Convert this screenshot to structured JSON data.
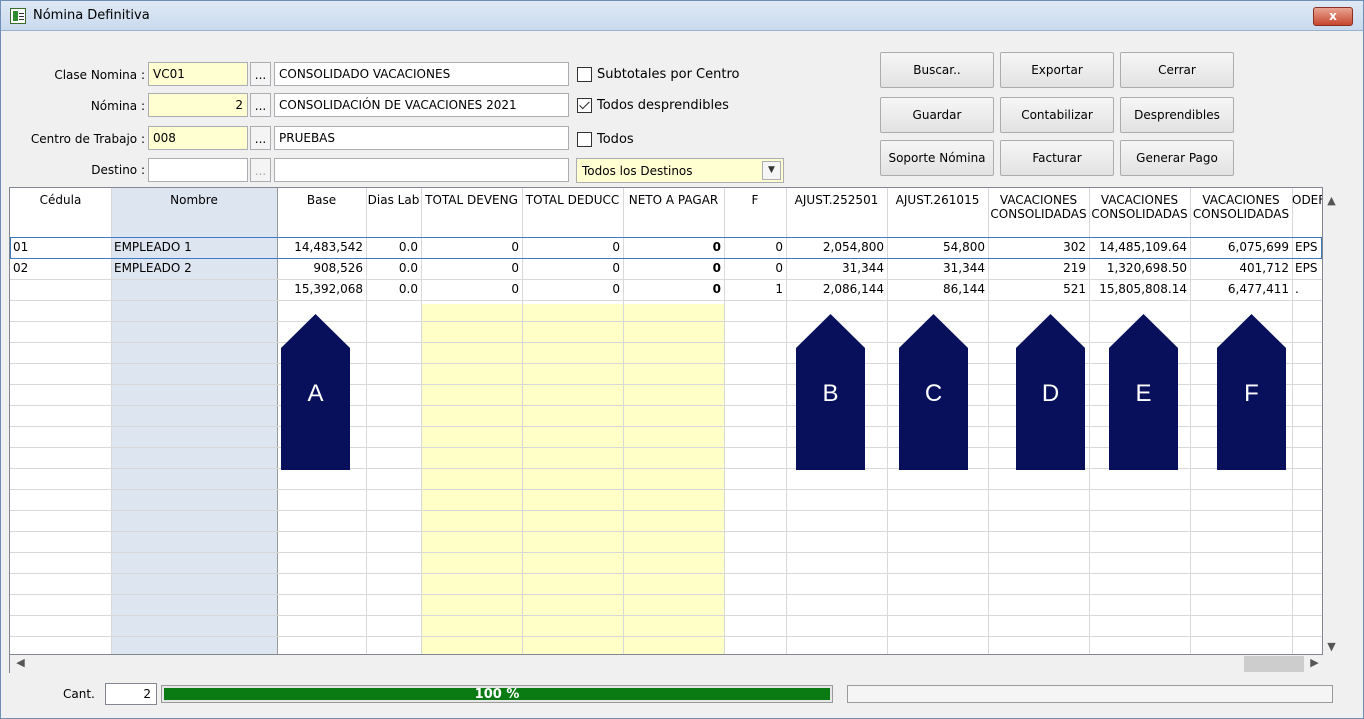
{
  "window": {
    "title": "Nómina Definitiva",
    "close_label": "x"
  },
  "form": {
    "clase_nomina": {
      "label": "Clase Nomina :",
      "code": "VC01",
      "desc": "CONSOLIDADO VACACIONES"
    },
    "nomina": {
      "label": "Nómina :",
      "code": "2",
      "desc": "CONSOLIDACIÓN DE VACACIONES 2021"
    },
    "centro": {
      "label": "Centro de Trabajo :",
      "code": "008",
      "desc": "PRUEBAS"
    },
    "destino": {
      "label": "Destino :",
      "code": "",
      "desc": ""
    },
    "dots": "..."
  },
  "options": {
    "subtotales": {
      "label": "Subtotales por Centro",
      "checked": false
    },
    "desprendibles": {
      "label": "Todos desprendibles",
      "checked": true
    },
    "todos": {
      "label": "Todos",
      "checked": false
    },
    "destinos": {
      "value": "Todos los Destinos"
    }
  },
  "buttons": {
    "buscar": "Buscar..",
    "exportar": "Exportar",
    "cerrar": "Cerrar",
    "guardar": "Guardar",
    "contabilizar": "Contabilizar",
    "desprendibles": "Desprendibles",
    "soporte": "Soporte Nómina",
    "facturar": "Facturar",
    "generar_pago": "Generar Pago"
  },
  "grid": {
    "columns": [
      {
        "line1": "Cédula",
        "line2": ""
      },
      {
        "line1": "Nombre",
        "line2": ""
      },
      {
        "line1": "Base",
        "line2": ""
      },
      {
        "line1": "Dias Lab",
        "line2": ""
      },
      {
        "line1": "TOTAL DEVENG",
        "line2": ""
      },
      {
        "line1": "TOTAL DEDUCC",
        "line2": ""
      },
      {
        "line1": "NETO A PAGAR",
        "line2": ""
      },
      {
        "line1": "F",
        "line2": ""
      },
      {
        "line1": "AJUST.252501",
        "line2": ""
      },
      {
        "line1": "AJUST.261015",
        "line2": ""
      },
      {
        "line1": "VACACIONES",
        "line2": "CONSOLIDADAS"
      },
      {
        "line1": "VACACIONES",
        "line2": "CONSOLIDADAS"
      },
      {
        "line1": "VACACIONES",
        "line2": "CONSOLIDADAS"
      },
      {
        "line1": "ODEF",
        "line2": ""
      }
    ],
    "rows": [
      [
        "01",
        "EMPLEADO 1",
        "14,483,542",
        "0.0",
        "0",
        "0",
        "0",
        "0",
        "2,054,800",
        "54,800",
        "302",
        "14,485,109.64",
        "6,075,699",
        "EPS"
      ],
      [
        "02",
        "EMPLEADO 2",
        "908,526",
        "0.0",
        "0",
        "0",
        "0",
        "0",
        "31,344",
        "31,344",
        "219",
        "1,320,698.50",
        "401,712",
        "EPS"
      ],
      [
        "",
        "",
        "15,392,068",
        "0.0",
        "0",
        "0",
        "0",
        "1",
        "2,086,144",
        "86,144",
        "521",
        "15,805,808.14",
        "6,477,411",
        "."
      ]
    ]
  },
  "markers": [
    "A",
    "B",
    "C",
    "D",
    "E",
    "F"
  ],
  "footer": {
    "cant_label": "Cant.",
    "cant_value": "2",
    "progress_text": "100 %",
    "progress": 1.0
  },
  "colors": {
    "marker": "#08105c",
    "progress": "#0a7a12",
    "field_highlight": "#ffffd2"
  }
}
